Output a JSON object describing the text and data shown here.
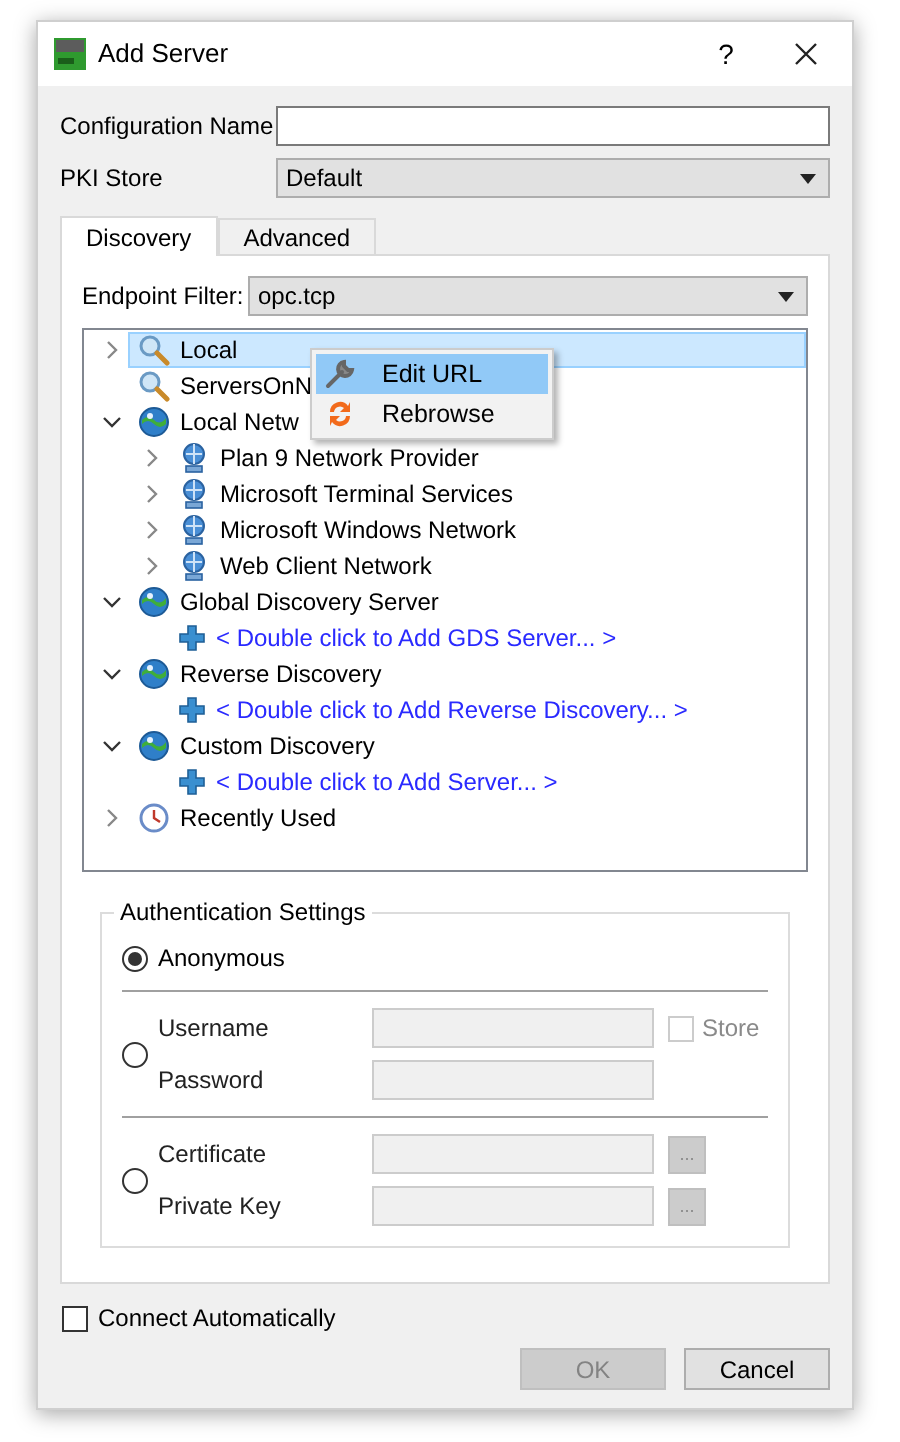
{
  "window": {
    "title": "Add Server",
    "help": "?"
  },
  "fields": [
    {
      "kind": "text",
      "label": "Configuration Name"
    },
    {
      "kind": "select",
      "label": "PKI Store",
      "value": "Default"
    }
  ],
  "tabs": [
    {
      "label": "Discovery",
      "selected": true
    },
    {
      "label": "Advanced",
      "selected": false
    }
  ],
  "endpoint_filter": {
    "label": "Endpoint Filter:",
    "value": "opc.tcp"
  },
  "tree": [
    {
      "label": "Local",
      "kind": "search",
      "expanded": false,
      "selected": true
    },
    {
      "label": "ServersOnN",
      "kind": "search",
      "selected": false
    },
    {
      "label": "Local Netw",
      "kind": "globe",
      "expanded": true,
      "selected": false,
      "children": [
        {
          "label": "Plan 9 Network Provider",
          "kind": "network",
          "expanded": false,
          "selected": false
        },
        {
          "label": "Microsoft Terminal Services",
          "kind": "network",
          "expanded": false,
          "selected": false
        },
        {
          "label": "Microsoft Windows Network",
          "kind": "network",
          "expanded": false,
          "selected": false
        },
        {
          "label": "Web Client Network",
          "kind": "network",
          "expanded": false,
          "selected": false
        }
      ]
    },
    {
      "label": "Global Discovery Server",
      "kind": "globe",
      "expanded": true,
      "selected": false,
      "children": [
        {
          "label": "< Double click to Add GDS Server... >",
          "kind": "add",
          "selected": false
        }
      ]
    },
    {
      "label": "Reverse Discovery",
      "kind": "globe",
      "expanded": true,
      "selected": false,
      "children": [
        {
          "label": "< Double click to Add Reverse Discovery... >",
          "kind": "add",
          "selected": false
        }
      ]
    },
    {
      "label": "Custom Discovery",
      "kind": "globe",
      "expanded": true,
      "selected": false,
      "children": [
        {
          "label": "< Double click to Add Server... >",
          "kind": "add",
          "selected": false
        }
      ]
    },
    {
      "label": "Recently Used",
      "kind": "recent",
      "expanded": false,
      "selected": false
    }
  ],
  "context_menu": [
    {
      "label": "Edit URL",
      "kind": "wrench",
      "selected": true
    },
    {
      "label": "Rebrowse",
      "kind": "refresh",
      "selected": false
    }
  ],
  "auth": {
    "title": "Authentication Settings",
    "options": [
      {
        "selected": true,
        "label": "Anonymous"
      },
      {
        "selected": false,
        "rows": [
          {
            "label": "Username",
            "extra": {
              "kind": "checkbox",
              "label": "Store",
              "checked": false,
              "disabled": true
            }
          },
          {
            "label": "Password"
          }
        ]
      },
      {
        "selected": false,
        "rows": [
          {
            "label": "Certificate",
            "extra": {
              "kind": "browse",
              "label": "..."
            }
          },
          {
            "label": "Private Key",
            "extra": {
              "kind": "browse",
              "label": "..."
            }
          }
        ]
      }
    ]
  },
  "connect_automatically": {
    "label": "Connect Automatically",
    "checked": false
  },
  "buttons": [
    {
      "label": "OK",
      "disabled": true
    },
    {
      "label": "Cancel",
      "disabled": false
    }
  ]
}
